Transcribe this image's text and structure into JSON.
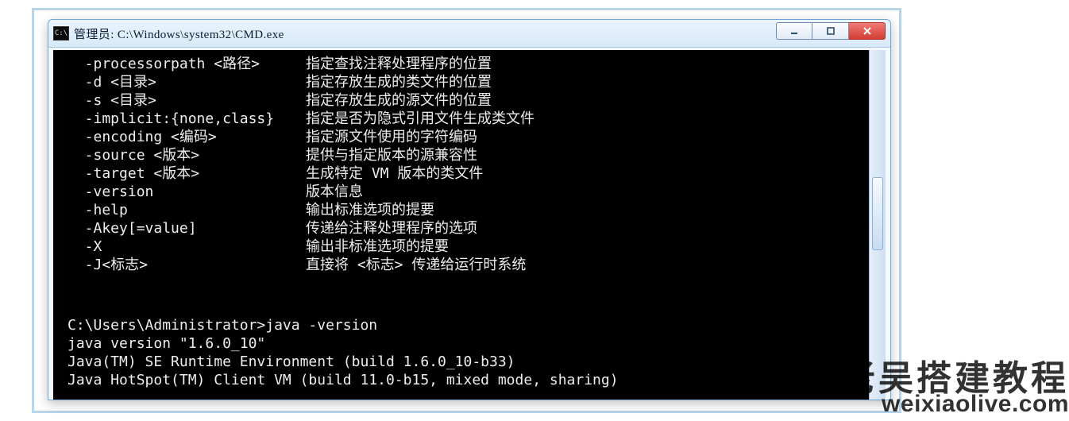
{
  "window": {
    "icon_text": "C:\\",
    "title": "管理员: C:\\Windows\\system32\\CMD.exe"
  },
  "help_lines": [
    {
      "flag": "  -processorpath <路径>",
      "desc": "指定查找注释处理程序的位置"
    },
    {
      "flag": "  -d <目录>",
      "desc": "指定存放生成的类文件的位置"
    },
    {
      "flag": "  -s <目录>",
      "desc": "指定存放生成的源文件的位置"
    },
    {
      "flag": "  -implicit:{none,class}",
      "desc": "指定是否为隐式引用文件生成类文件"
    },
    {
      "flag": "  -encoding <编码>",
      "desc": "指定源文件使用的字符编码"
    },
    {
      "flag": "  -source <版本>",
      "desc": "提供与指定版本的源兼容性"
    },
    {
      "flag": "  -target <版本>",
      "desc": "生成特定 VM 版本的类文件"
    },
    {
      "flag": "  -version",
      "desc": "版本信息"
    },
    {
      "flag": "  -help",
      "desc": "输出标准选项的提要"
    },
    {
      "flag": "  -Akey[=value]",
      "desc": "传递给注释处理程序的选项"
    },
    {
      "flag": "  -X",
      "desc": "输出非标准选项的提要"
    },
    {
      "flag": "  -J<标志>",
      "desc": "直接将 <标志> 传递给运行时系统"
    }
  ],
  "prompt_line": "C:\\Users\\Administrator>java -version",
  "output_lines": [
    "java version \"1.6.0_10\"",
    "Java(TM) SE Runtime Environment (build 1.6.0_10-b33)",
    "Java HotSpot(TM) Client VM (build 11.0-b15, mixed mode, sharing)"
  ],
  "watermark": {
    "cn": "老吴搭建教程",
    "en": "weixiaolive.com"
  }
}
